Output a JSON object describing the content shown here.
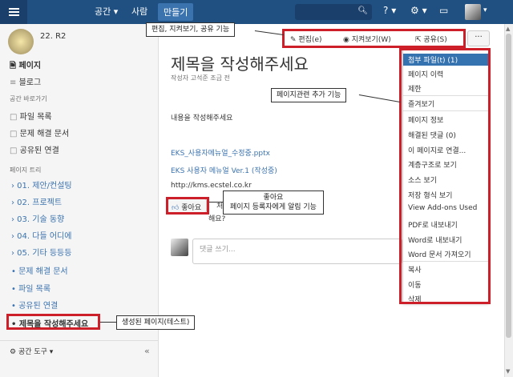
{
  "topbar": {
    "nav_space": "공간 ▾",
    "nav_people": "사람",
    "nav_create": "만들기",
    "help_icon": "?",
    "gear_icon": "⚙",
    "inbox_icon": "▭"
  },
  "sidebar": {
    "space_name": "22. R2",
    "pages_label": "페이지",
    "blog_label": "블로그",
    "shortcuts_heading": "공간 바로가기",
    "shortcuts": [
      "파일 목록",
      "문제 해결 문서",
      "공유된 연결"
    ],
    "tree_heading": "페이지 트리",
    "tree": [
      "› 01. 제안/컨설팅",
      "› 02. 프로젝트",
      "› 03. 기술 동향",
      "› 04. 다들 어디에",
      "› 05. 기타 등등등",
      "• 문제 해결 문서",
      "• 파일 목록",
      "• 공유된 연결",
      "• 제목을 작성해주세요"
    ],
    "space_tools": "공간 도구 ▾",
    "collapse": "«"
  },
  "page": {
    "actions": {
      "edit": "편집(e)",
      "watch": "지켜보기(W)",
      "share": "공유(S)",
      "more": "···"
    },
    "title": "제목을 작성해주세요",
    "byline": "작성자 고석준 조금 전",
    "body_text": "내용을 작성해주세요",
    "links": [
      "EKS_사용자메뉴얼_수정중.pptx",
      "EKS 사용자 메뉴얼 Ver.1 (작성중)",
      "http://kms.ecstel.co.kr"
    ],
    "like_label": "좋아요",
    "like_suffix": "처",
    "like_suffix2": "해요?",
    "comment_placeholder": "댓글 쓰기..."
  },
  "dropdown": {
    "group1": [
      "첨부 파일(t) (1)",
      "페이지 이력",
      "제한"
    ],
    "group2": [
      "즐겨보기"
    ],
    "group3": [
      "페이지 정보",
      "해결된 댓글 (0)",
      "이 페이지로 연결...",
      "계층구조로 보기",
      "소스 보기",
      "저장 형식 보기",
      "View Add-ons Used",
      "PDF로 내보내기",
      "Word로 내보내기",
      "Word 문서 가져오기"
    ],
    "group4": [
      "복사",
      "이동",
      "삭제"
    ]
  },
  "annotations": {
    "edit_watch_share": "편집, 지켜보기, 공유 기능",
    "page_extra": "페이지관련 추가 기능",
    "like_line1": "좋아요",
    "like_line2": "페이지 등록자에게 알림 기능",
    "created_page": "생성된 페이지(테스트)"
  },
  "colors": {
    "topbar": "#205081",
    "link": "#3b73af",
    "highlight": "#3572b0",
    "annotation_box": "#cc1f2a"
  }
}
